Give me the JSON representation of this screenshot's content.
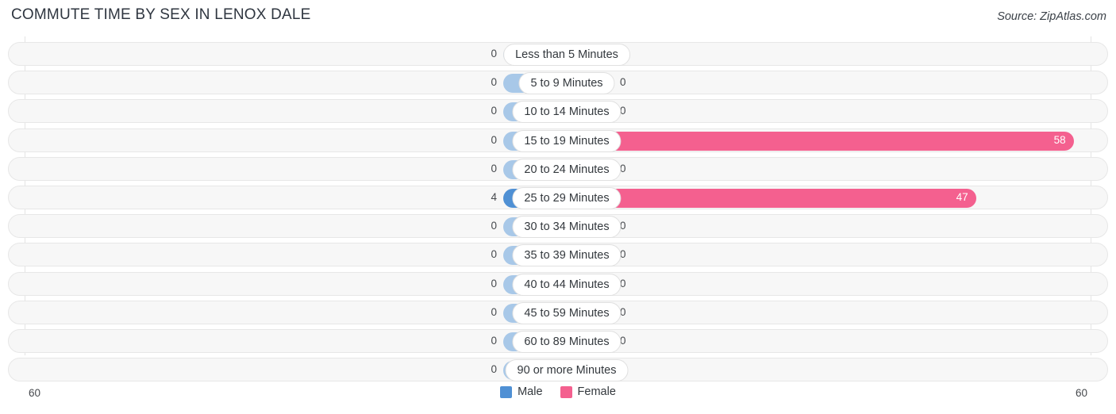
{
  "header": {
    "title": "COMMUTE TIME BY SEX IN LENOX DALE",
    "source": "Source: ZipAtlas.com"
  },
  "axis": {
    "left_max_label": "60",
    "right_max_label": "60"
  },
  "legend": {
    "items": [
      {
        "label": "Male",
        "color": "#4f90d4",
        "key": "male"
      },
      {
        "label": "Female",
        "color": "#f4608f",
        "key": "female"
      }
    ]
  },
  "colors": {
    "male": "#4f90d4",
    "female": "#f4608f",
    "male_zero": "#a8c8e8",
    "female_zero": "#f9a6c3",
    "row_track": "#f7f7f7",
    "row_border": "#e7e7e7",
    "gridline": "#e3e3e3",
    "title": "#2f3640"
  },
  "chart_data": {
    "type": "bar",
    "title": "COMMUTE TIME BY SEX IN LENOX DALE",
    "orientation": "horizontal-diverging",
    "xlabel": "",
    "ylabel": "",
    "axis_max": 60,
    "left_axis_ticks": [
      "60"
    ],
    "right_axis_ticks": [
      "60"
    ],
    "grid": true,
    "legend_position": "bottom-center",
    "categories": [
      "Less than 5 Minutes",
      "5 to 9 Minutes",
      "10 to 14 Minutes",
      "15 to 19 Minutes",
      "20 to 24 Minutes",
      "25 to 29 Minutes",
      "30 to 34 Minutes",
      "35 to 39 Minutes",
      "40 to 44 Minutes",
      "45 to 59 Minutes",
      "60 to 89 Minutes",
      "90 or more Minutes"
    ],
    "series": [
      {
        "name": "Male",
        "values": [
          0,
          0,
          0,
          0,
          0,
          4,
          0,
          0,
          0,
          0,
          0,
          0
        ]
      },
      {
        "name": "Female",
        "values": [
          0,
          0,
          0,
          58,
          0,
          47,
          0,
          0,
          0,
          0,
          0,
          0
        ]
      }
    ]
  },
  "rows": [
    {
      "label": "Less than 5 Minutes",
      "male": "0",
      "female": "0"
    },
    {
      "label": "5 to 9 Minutes",
      "male": "0",
      "female": "0"
    },
    {
      "label": "10 to 14 Minutes",
      "male": "0",
      "female": "0"
    },
    {
      "label": "15 to 19 Minutes",
      "male": "0",
      "female": "58"
    },
    {
      "label": "20 to 24 Minutes",
      "male": "0",
      "female": "0"
    },
    {
      "label": "25 to 29 Minutes",
      "male": "4",
      "female": "47"
    },
    {
      "label": "30 to 34 Minutes",
      "male": "0",
      "female": "0"
    },
    {
      "label": "35 to 39 Minutes",
      "male": "0",
      "female": "0"
    },
    {
      "label": "40 to 44 Minutes",
      "male": "0",
      "female": "0"
    },
    {
      "label": "45 to 59 Minutes",
      "male": "0",
      "female": "0"
    },
    {
      "label": "60 to 89 Minutes",
      "male": "0",
      "female": "0"
    },
    {
      "label": "90 or more Minutes",
      "male": "0",
      "female": "0"
    }
  ]
}
